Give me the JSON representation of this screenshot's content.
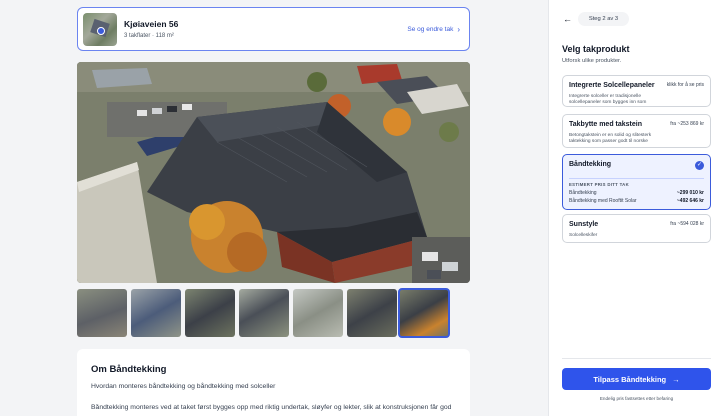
{
  "address": {
    "title": "Kjøiaveien 56",
    "subtitle": "3 takflater · 118 m²",
    "link": "Se og endre tak",
    "link_icon": "chevron-right-icon"
  },
  "gallery": {
    "thumbnail_count": 7,
    "active_index": 6
  },
  "info": {
    "title": "Om Båndtekking",
    "question": "Hvordan monteres båndtekking og båndtekking med solceller",
    "body": "Båndtekking monteres ved at taket først bygges opp med riktig undertak, sløyfer og lekter, slik at konstruksjonen får god"
  },
  "panel": {
    "back_icon": "arrow-left-icon",
    "step": "Steg 2 av 3",
    "title": "Velg takprodukt",
    "subtitle": "Utforsk ulike produkter.",
    "options": [
      {
        "name": "Integrerte Solcellepaneler",
        "price": "klikk for å se pris",
        "desc": "Integrerte solceller er tradisjonelle solcellepaneler som bygges inn som"
      },
      {
        "name": "Takbytte med takstein",
        "price": "fra ~253 869 kr",
        "desc": "Betongtakstein er en solid og slitesterk taktekking som passer godt til norske"
      },
      {
        "name": "Båndtekking",
        "selected": true,
        "estimate_label": "ESTIMERT PRIS DITT TAK",
        "rows": [
          {
            "label": "Båndtekking",
            "value": "~299 010 kr"
          },
          {
            "label": "Båndtekking med Rooftit Solar",
            "value": "~492 646 kr"
          }
        ]
      },
      {
        "name": "Sunstyle",
        "price": "fra ~594 028 kr",
        "desc": "Solcelleskifer"
      }
    ],
    "cta": "Tilpass Båndtekking",
    "cta_icon": "arrow-right-icon",
    "footnote": "Endelig pris fastsettes etter befaring"
  },
  "colors": {
    "accent": "#2f54eb",
    "selected_bg": "#eef2ff",
    "page_bg": "#f3f4f6"
  }
}
